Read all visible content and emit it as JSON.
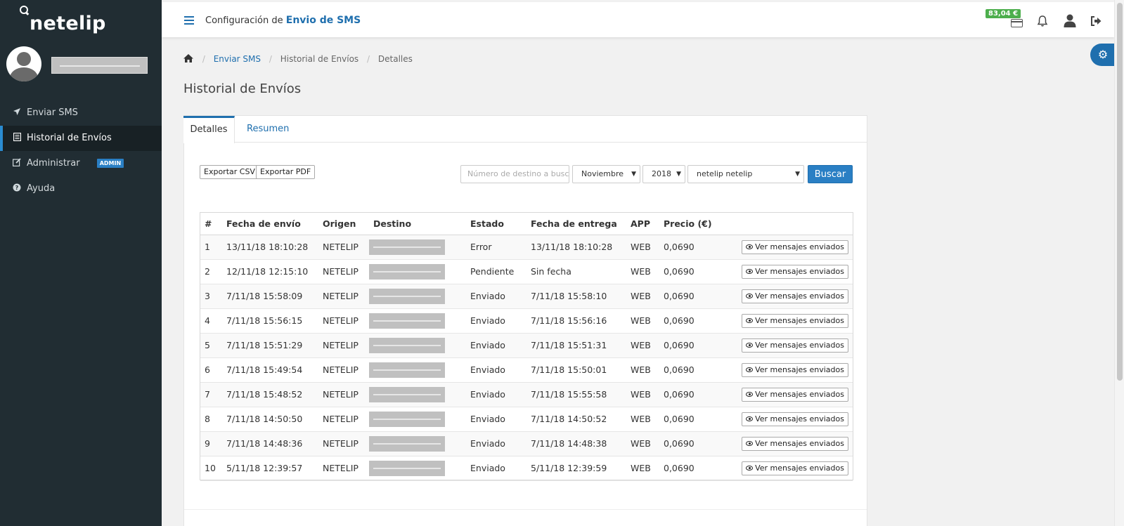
{
  "app": {
    "logo_text": "netelip"
  },
  "sidebar": {
    "items": [
      {
        "label": "Enviar SMS",
        "icon": "paper-plane-icon",
        "active": false
      },
      {
        "label": "Historial de Envíos",
        "icon": "list-icon",
        "active": true
      },
      {
        "label": "Administrar",
        "icon": "edit-icon",
        "active": false,
        "badge": "ADMIN"
      },
      {
        "label": "Ayuda",
        "icon": "question-circle-icon",
        "active": false
      }
    ]
  },
  "header": {
    "prefix": "Configuración de",
    "section": "Envio de SMS",
    "balance": "83,04 €"
  },
  "breadcrumb": {
    "items": [
      "Enviar SMS",
      "Historial de Envíos",
      "Detalles"
    ]
  },
  "page": {
    "title": "Historial de Envíos"
  },
  "tabs": [
    "Detalles",
    "Resumen"
  ],
  "toolbar": {
    "export_csv": "Exportar CSV",
    "export_pdf": "Exportar PDF",
    "search_placeholder": "Número de destino a buscar",
    "month": "Noviembre",
    "year": "2018",
    "account": "netelip netelip",
    "search_button": "Buscar"
  },
  "table": {
    "headers": [
      "#",
      "Fecha de envío",
      "Origen",
      "Destino",
      "Estado",
      "Fecha de entrega",
      "APP",
      "Precio (€)",
      ""
    ],
    "view_label": "Ver mensajes enviados",
    "rows": [
      {
        "n": "1",
        "sent": "13/11/18 18:10:28",
        "origin": "NETELIP",
        "status": "Error",
        "delivered": "13/11/18 18:10:28",
        "app": "WEB",
        "price": "0,0690"
      },
      {
        "n": "2",
        "sent": "12/11/18 12:15:10",
        "origin": "NETELIP",
        "status": "Pendiente",
        "delivered": "Sin fecha",
        "app": "WEB",
        "price": "0,0690"
      },
      {
        "n": "3",
        "sent": "7/11/18 15:58:09",
        "origin": "NETELIP",
        "status": "Enviado",
        "delivered": "7/11/18 15:58:10",
        "app": "WEB",
        "price": "0,0690"
      },
      {
        "n": "4",
        "sent": "7/11/18 15:56:15",
        "origin": "NETELIP",
        "status": "Enviado",
        "delivered": "7/11/18 15:56:16",
        "app": "WEB",
        "price": "0,0690"
      },
      {
        "n": "5",
        "sent": "7/11/18 15:51:29",
        "origin": "NETELIP",
        "status": "Enviado",
        "delivered": "7/11/18 15:51:31",
        "app": "WEB",
        "price": "0,0690"
      },
      {
        "n": "6",
        "sent": "7/11/18 15:49:54",
        "origin": "NETELIP",
        "status": "Enviado",
        "delivered": "7/11/18 15:50:01",
        "app": "WEB",
        "price": "0,0690"
      },
      {
        "n": "7",
        "sent": "7/11/18 15:48:52",
        "origin": "NETELIP",
        "status": "Enviado",
        "delivered": "7/11/18 15:55:58",
        "app": "WEB",
        "price": "0,0690"
      },
      {
        "n": "8",
        "sent": "7/11/18 14:50:50",
        "origin": "NETELIP",
        "status": "Enviado",
        "delivered": "7/11/18 14:50:52",
        "app": "WEB",
        "price": "0,0690"
      },
      {
        "n": "9",
        "sent": "7/11/18 14:48:36",
        "origin": "NETELIP",
        "status": "Enviado",
        "delivered": "7/11/18 14:48:38",
        "app": "WEB",
        "price": "0,0690"
      },
      {
        "n": "10",
        "sent": "5/11/18 12:39:57",
        "origin": "NETELIP",
        "status": "Enviado",
        "delivered": "5/11/18 12:39:59",
        "app": "WEB",
        "price": "0,0690"
      }
    ]
  },
  "colors": {
    "sidebar_bg": "#212d33",
    "accent": "#1f6fae",
    "balance_badge": "#4cae4c"
  }
}
